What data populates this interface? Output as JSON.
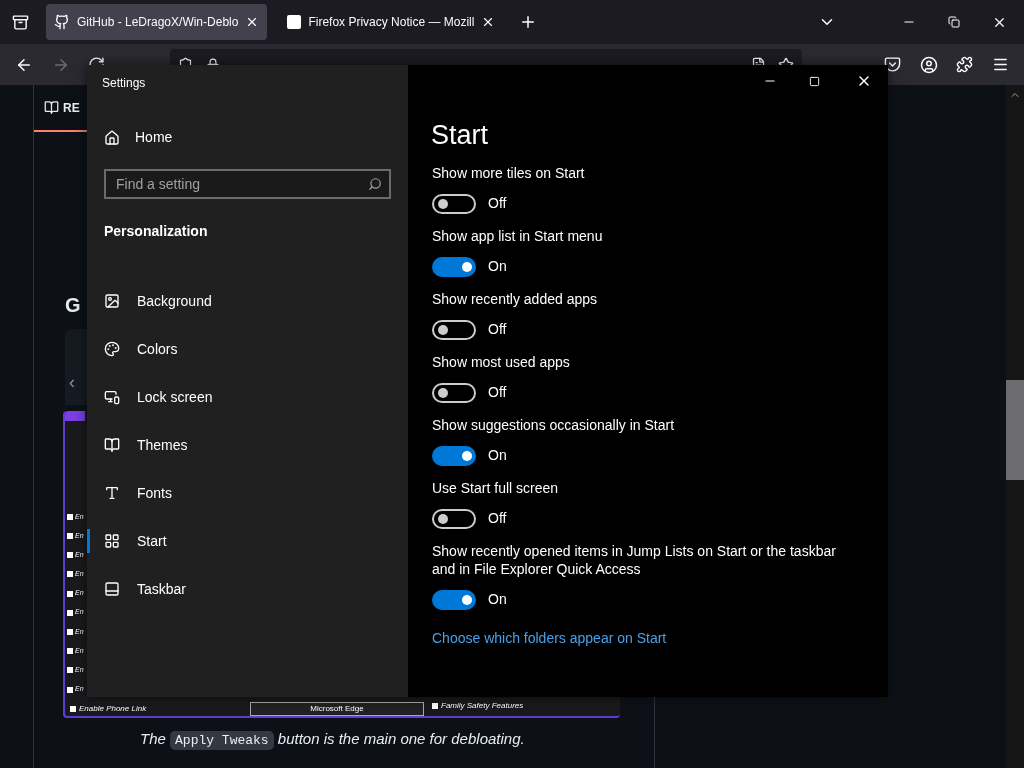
{
  "browser": {
    "tabs": [
      {
        "title": "GitHub - LeDragoX/Win-Deblo",
        "selected": true
      },
      {
        "title": "Firefox Privacy Notice — Mozill",
        "selected": false
      }
    ],
    "forward_disabled": true
  },
  "page": {
    "readme_tab": "RE",
    "heading": "G",
    "panel_arrow": "‹",
    "screenshot": {
      "list": [
        "En",
        "En",
        "En",
        "En",
        "En",
        "En",
        "En",
        "En",
        "En",
        "En"
      ],
      "footer_item": "Enable Phone Link",
      "button": "Microsoft Edge",
      "right_item": "Family Safety Features"
    },
    "caption": {
      "before": "The",
      "code": "Apply Tweaks",
      "after": "button is the main one for debloating."
    }
  },
  "settings": {
    "title": "Settings",
    "home": "Home",
    "search": {
      "placeholder": "Find a setting"
    },
    "section": "Personalization",
    "nav": [
      {
        "label": "Background",
        "selected": false
      },
      {
        "label": "Colors",
        "selected": false
      },
      {
        "label": "Lock screen",
        "selected": false
      },
      {
        "label": "Themes",
        "selected": false
      },
      {
        "label": "Fonts",
        "selected": false
      },
      {
        "label": "Start",
        "selected": true
      },
      {
        "label": "Taskbar",
        "selected": false
      }
    ],
    "page_title": "Start",
    "options": [
      {
        "label": "Show more tiles on Start",
        "on": false,
        "state_text": "Off"
      },
      {
        "label": "Show app list in Start menu",
        "on": true,
        "state_text": "On"
      },
      {
        "label": "Show recently added apps",
        "on": false,
        "state_text": "Off"
      },
      {
        "label": "Show most used apps",
        "on": false,
        "state_text": "Off"
      },
      {
        "label": "Show suggestions occasionally in Start",
        "on": true,
        "state_text": "On"
      },
      {
        "label": "Use Start full screen",
        "on": false,
        "state_text": "Off"
      },
      {
        "label": "Show recently opened items in Jump Lists on Start or the taskbar and in File Explorer Quick Access",
        "on": true,
        "state_text": "On"
      }
    ],
    "link": "Choose which folders appear on Start"
  }
}
